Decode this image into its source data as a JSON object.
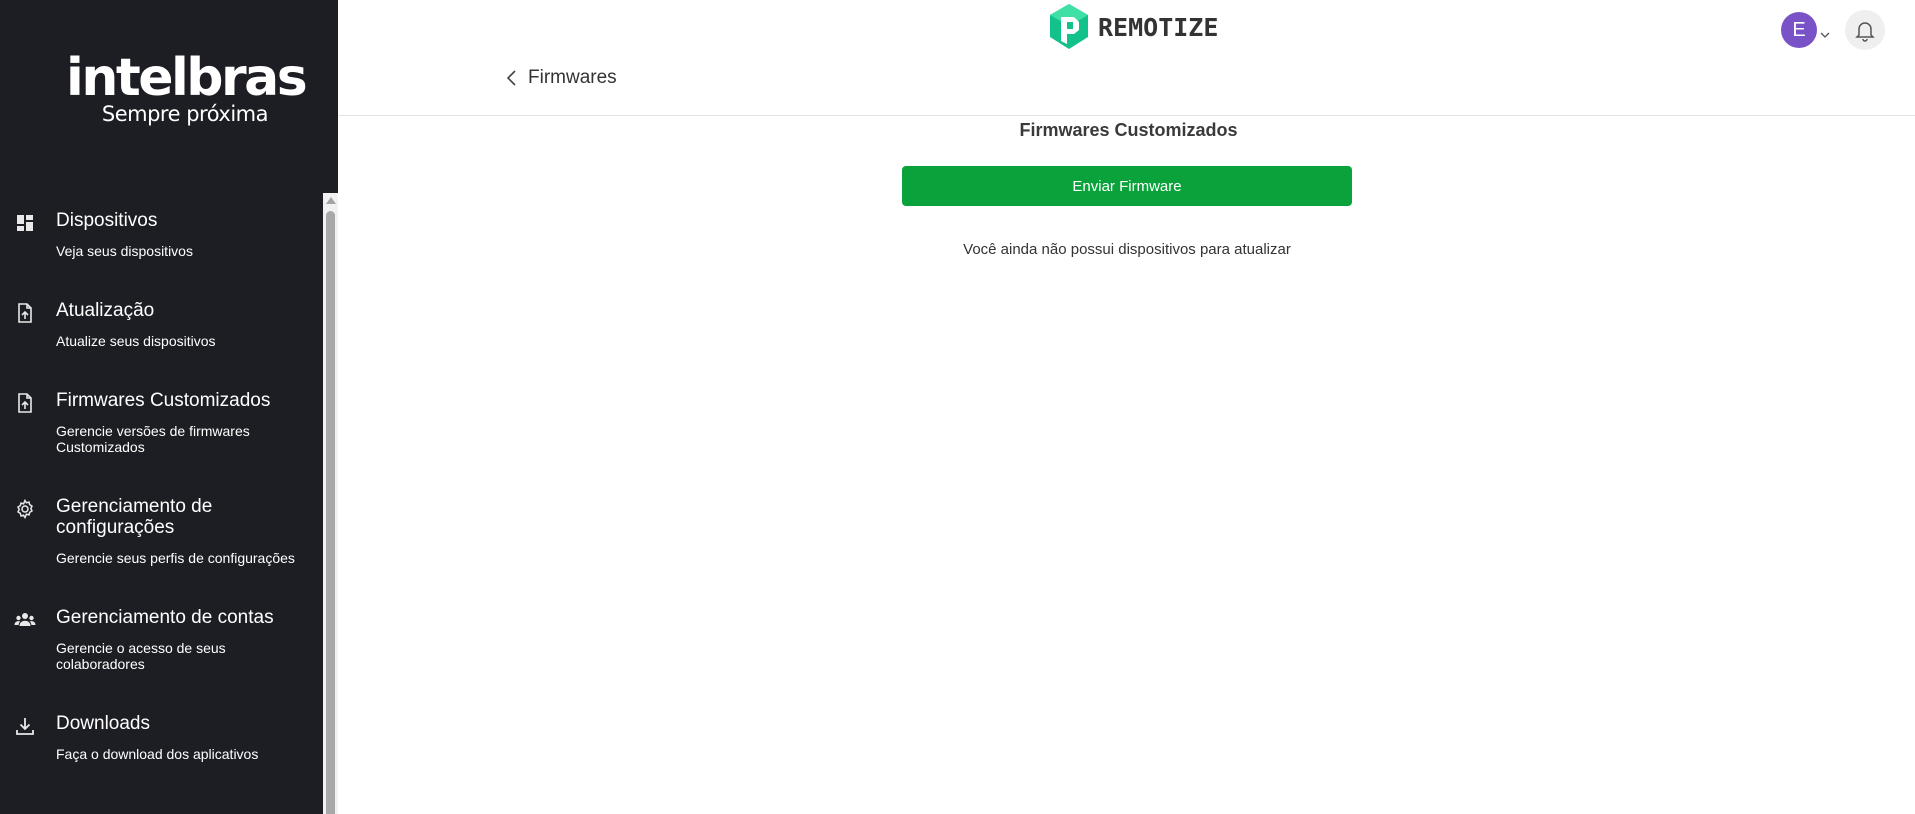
{
  "sidebar": {
    "logo": {
      "word": "intelbras",
      "tagline": "Sempre próxima"
    },
    "items": [
      {
        "title": "Dispositivos",
        "desc": "Veja seus dispositivos",
        "icon": "dashboard-icon"
      },
      {
        "title": "Atualização",
        "desc": "Atualize seus dispositivos",
        "icon": "file-upload-icon"
      },
      {
        "title": "Firmwares Customizados",
        "desc": "Gerencie versões de firmwares Customizados",
        "icon": "file-upload-icon"
      },
      {
        "title": "Gerenciamento de configurações",
        "desc": "Gerencie seus perfis de configurações",
        "icon": "gear-icon"
      },
      {
        "title": "Gerenciamento de contas",
        "desc": "Gerencie o acesso de seus colaboradores",
        "icon": "users-icon"
      },
      {
        "title": "Downloads",
        "desc": "Faça o download dos aplicativos",
        "icon": "download-icon"
      }
    ]
  },
  "header": {
    "brand": "REMOTIZE",
    "back_label": "Firmwares",
    "avatar_initial": "E"
  },
  "main": {
    "title": "Firmwares Customizados",
    "send_button": "Enviar Firmware",
    "empty_message": "Você ainda não possui dispositivos para atualizar"
  },
  "colors": {
    "sidebar_bg": "#1c1e24",
    "primary_green": "#0aa23a",
    "avatar_purple": "#7a52c7",
    "brand_green": "#12c28a"
  }
}
